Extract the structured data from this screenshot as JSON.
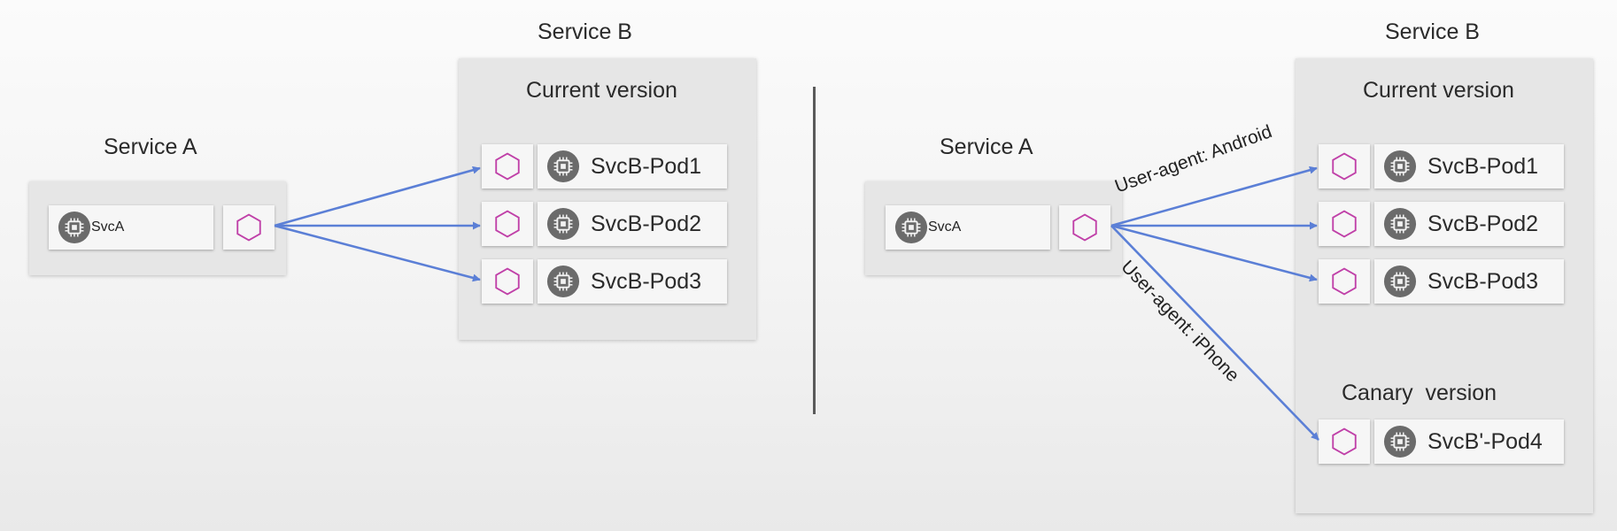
{
  "left": {
    "service_a": {
      "title": "Service A",
      "pod": "SvcA"
    },
    "service_b": {
      "title": "Service B",
      "current_title": "Current version",
      "pods": [
        "SvcB-Pod1",
        "SvcB-Pod2",
        "SvcB-Pod3"
      ]
    }
  },
  "right": {
    "service_a": {
      "title": "Service A",
      "pod": "SvcA"
    },
    "service_b": {
      "title": "Service B",
      "current_title": "Current version",
      "pods": [
        "SvcB-Pod1",
        "SvcB-Pod2",
        "SvcB-Pod3"
      ],
      "canary_title": "Canary  version",
      "canary_pod": "SvcB'-Pod4"
    },
    "edge_labels": {
      "android": "User-agent: Android",
      "iphone": "User-agent: iPhone"
    }
  },
  "colors": {
    "arrow": "#5b7fd6",
    "envoy_hex": "#c040a8",
    "chip": "#6b6b6b"
  },
  "icons": {
    "pod": "chip-icon",
    "proxy": "hexagon-icon"
  }
}
